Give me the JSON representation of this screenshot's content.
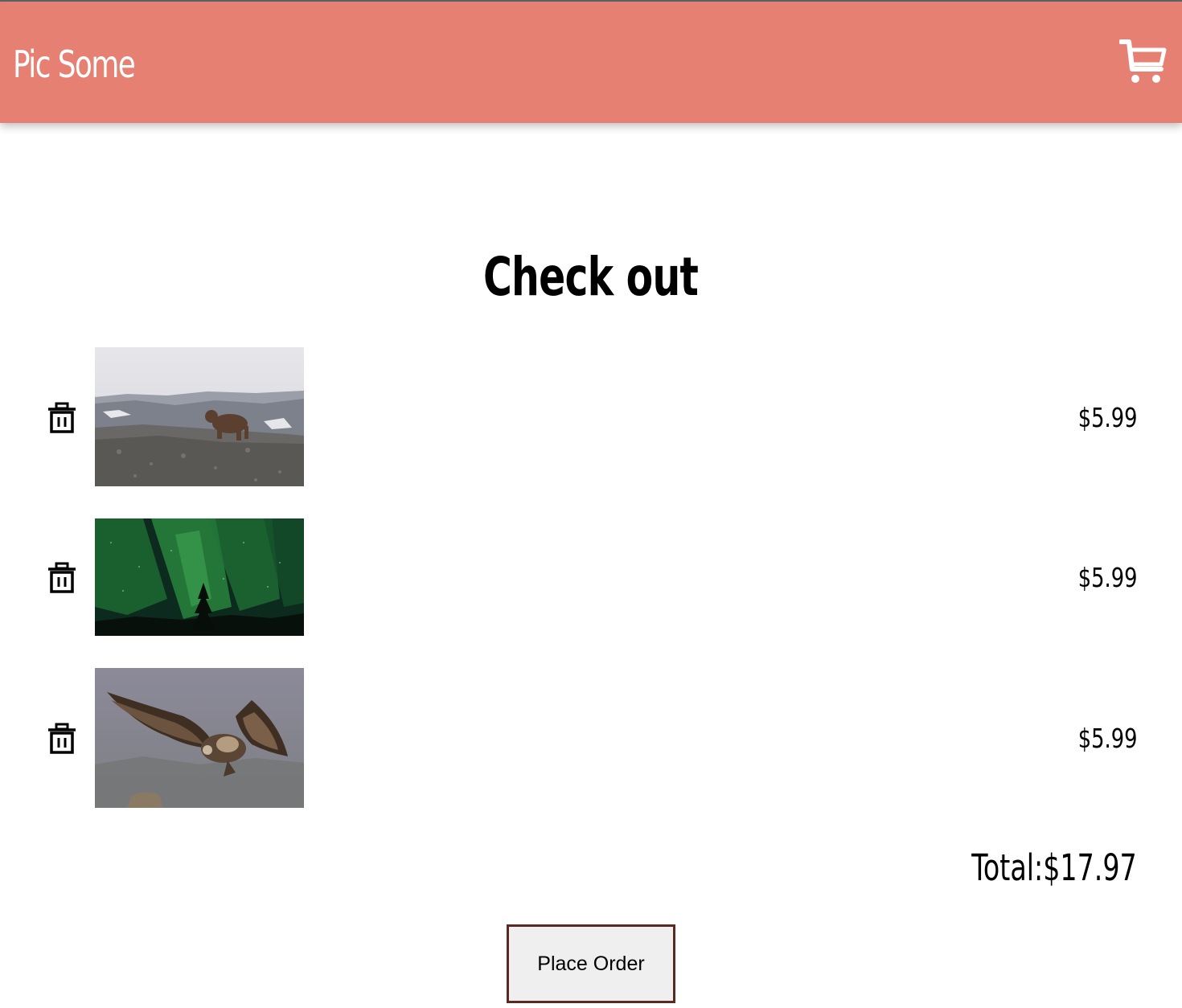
{
  "header": {
    "brand": "Pic Some",
    "cart_icon": "shopping-cart-icon",
    "color": "#e58073"
  },
  "page": {
    "title": "Check out"
  },
  "cart": {
    "items": [
      {
        "image": "grizzly bear on rocky hillside",
        "price": "$5.99",
        "remove_icon": "trash-icon"
      },
      {
        "image": "green northern lights over trees",
        "price": "$5.99",
        "remove_icon": "trash-icon"
      },
      {
        "image": "vulture with spread wings in flight",
        "price": "$5.99",
        "remove_icon": "trash-icon"
      }
    ],
    "total": "Total:$17.97"
  },
  "order": {
    "button_label": "Place Order"
  }
}
